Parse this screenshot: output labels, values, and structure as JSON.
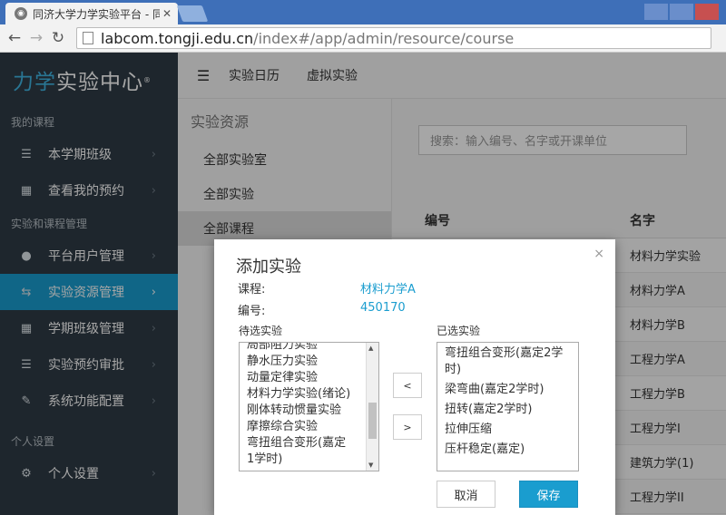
{
  "browser": {
    "tab_title": "同济大学力学实验平台 - 同",
    "url_host": "labcom.tongji.edu.cn",
    "url_path": "/index#/app/admin/resource/course"
  },
  "sidebar": {
    "brand_part1": "力学",
    "brand_part2": "实验中心",
    "brand_mark": "®",
    "sections": [
      {
        "title": "我的课程",
        "items": [
          {
            "label": "本学期班级",
            "icon": "list-icon"
          },
          {
            "label": "查看我的预约",
            "icon": "calendar-icon"
          }
        ]
      },
      {
        "title": "实验和课程管理",
        "items": [
          {
            "label": "平台用户管理",
            "icon": "user-icon"
          },
          {
            "label": "实验资源管理",
            "icon": "retweet-icon",
            "active": true
          },
          {
            "label": "学期班级管理",
            "icon": "grid-icon"
          },
          {
            "label": "实验预约审批",
            "icon": "list-icon"
          },
          {
            "label": "系统功能配置",
            "icon": "wrench-icon"
          }
        ]
      },
      {
        "title": "个人设置",
        "items": [
          {
            "label": "个人设置",
            "icon": "gear-icon"
          }
        ]
      }
    ]
  },
  "topnav": {
    "links": [
      "实验日历",
      "虚拟实验"
    ]
  },
  "resnav": {
    "title": "实验资源",
    "items": [
      "全部实验室",
      "全部实验",
      "全部课程"
    ],
    "active_index": 2
  },
  "search": {
    "placeholder": "搜索：输入编号、名字或开课单位"
  },
  "table": {
    "headers": [
      "编号",
      "名字"
    ],
    "rows": [
      {
        "id": "",
        "name": "材料力学实验"
      },
      {
        "id": "",
        "name": "材料力学A"
      },
      {
        "id": "",
        "name": "材料力学B"
      },
      {
        "id": "",
        "name": "工程力学A"
      },
      {
        "id": "",
        "name": "工程力学B"
      },
      {
        "id": "",
        "name": "工程力学I"
      },
      {
        "id": "",
        "name": "建筑力学(1)"
      },
      {
        "id": "",
        "name": "工程力学II"
      }
    ]
  },
  "modal": {
    "title": "添加实验",
    "close_icon": "×",
    "course_label": "课程:",
    "course_value": "材料力学A",
    "code_label": "编号:",
    "code_value": "450170",
    "available_label": "待选实验",
    "selected_label": "已选实验",
    "available": [
      "局部阻力实验",
      "静水压力实验",
      "动量定律实验",
      "材料力学实验(绪论)",
      "刚体转动惯量实验",
      "摩擦综合实验",
      "弯扭组合变形(嘉定",
      " 1学时)"
    ],
    "selected": [
      "弯扭组合变形(嘉定2学时)",
      "梁弯曲(嘉定2学时)",
      "扭转(嘉定2学时)",
      "拉伸压缩",
      "压杆稳定(嘉定)"
    ],
    "move_left": "<",
    "move_right": ">",
    "cancel": "取消",
    "save": "保存"
  }
}
